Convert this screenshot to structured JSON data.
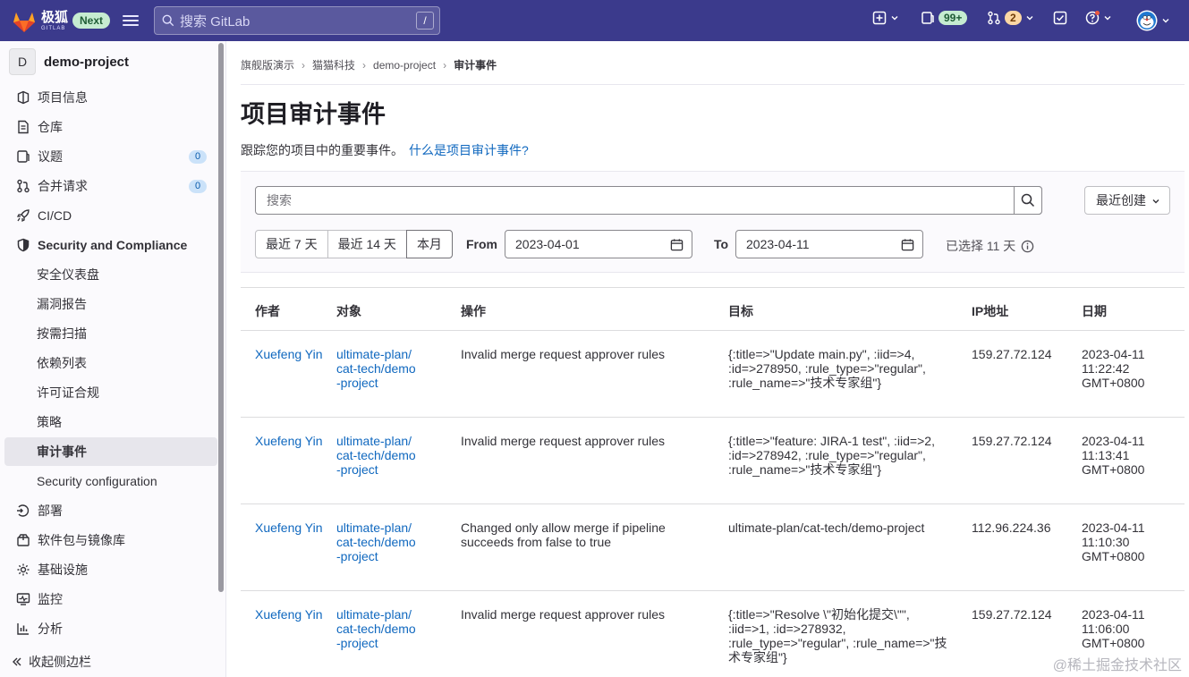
{
  "topbar": {
    "logo_cn": "极狐",
    "logo_en": "GITLAB",
    "next_badge": "Next",
    "search_placeholder": "搜索 GitLab",
    "search_shortcut": "/",
    "issues_count": "99+",
    "mr_count": "2"
  },
  "sidebar": {
    "project_avatar": "D",
    "project_name": "demo-project",
    "items": [
      {
        "label": "项目信息",
        "icon": "project-info-icon"
      },
      {
        "label": "仓库",
        "icon": "repository-icon"
      },
      {
        "label": "议题",
        "icon": "issues-icon",
        "count": "0"
      },
      {
        "label": "合并请求",
        "icon": "merge-request-icon",
        "count": "0"
      },
      {
        "label": "CI/CD",
        "icon": "rocket-icon"
      },
      {
        "label": "Security and Compliance",
        "icon": "shield-icon"
      },
      {
        "label": "安全仪表盘"
      },
      {
        "label": "漏洞报告"
      },
      {
        "label": "按需扫描"
      },
      {
        "label": "依赖列表"
      },
      {
        "label": "许可证合规"
      },
      {
        "label": "策略"
      },
      {
        "label": "审计事件"
      },
      {
        "label": "Security configuration"
      },
      {
        "label": "部署",
        "icon": "deployments-icon"
      },
      {
        "label": "软件包与镜像库",
        "icon": "package-icon"
      },
      {
        "label": "基础设施",
        "icon": "cloud-gear-icon"
      },
      {
        "label": "监控",
        "icon": "monitor-icon"
      },
      {
        "label": "分析",
        "icon": "chart-icon"
      }
    ],
    "collapse_label": "收起侧边栏"
  },
  "breadcrumb": [
    "旗舰版演示",
    "猫猫科技",
    "demo-project",
    "审计事件"
  ],
  "page": {
    "title": "项目审计事件",
    "description": "跟踪您的项目中的重要事件。",
    "help_link": "什么是项目审计事件?"
  },
  "filters": {
    "search_placeholder": "搜索",
    "sort_label": "最近创建",
    "ranges": [
      "最近 7 天",
      "最近 14 天",
      "本月"
    ],
    "from_label": "From",
    "from_date": "2023-04-01",
    "to_label": "To",
    "to_date": "2023-04-11",
    "selected_info": "已选择 11 天"
  },
  "table": {
    "headers": [
      "作者",
      "对象",
      "操作",
      "目标",
      "IP地址",
      "日期"
    ],
    "rows": [
      {
        "author": "Xuefeng Yin",
        "object": "ultimate-plan/cat-tech/demo-project",
        "action": "Invalid merge request approver rules",
        "target": "{:title=>\"Update main.py\", :iid=>4, :id=>278950, :rule_type=>\"regular\", :rule_name=>\"技术专家组\"}",
        "ip": "159.27.72.124",
        "date": "2023-04-11 11:22:42 GMT+0800"
      },
      {
        "author": "Xuefeng Yin",
        "object": "ultimate-plan/cat-tech/demo-project",
        "action": "Invalid merge request approver rules",
        "target": "{:title=>\"feature: JIRA-1 test\", :iid=>2, :id=>278942, :rule_type=>\"regular\", :rule_name=>\"技术专家组\"}",
        "ip": "159.27.72.124",
        "date": "2023-04-11 11:13:41 GMT+0800"
      },
      {
        "author": "Xuefeng Yin",
        "object": "ultimate-plan/cat-tech/demo-project",
        "action": "Changed only allow merge if pipeline succeeds from false to true",
        "target": "ultimate-plan/cat-tech/demo-project",
        "ip": "112.96.224.36",
        "date": "2023-04-11 11:10:30 GMT+0800"
      },
      {
        "author": "Xuefeng Yin",
        "object": "ultimate-plan/cat-tech/demo-project",
        "action": "Invalid merge request approver rules",
        "target": "{:title=>\"Resolve \\\"初始化提交\\\"\", :iid=>1, :id=>278932, :rule_type=>\"regular\", :rule_name=>\"技术专家组\"}",
        "ip": "159.27.72.124",
        "date": "2023-04-11 11:06:00 GMT+0800"
      }
    ]
  },
  "watermark": "@稀土掘金技术社区",
  "colors": {
    "topbar": "#3b3a8c",
    "link": "#1068bf",
    "active_nav": "#e7e6ec"
  }
}
